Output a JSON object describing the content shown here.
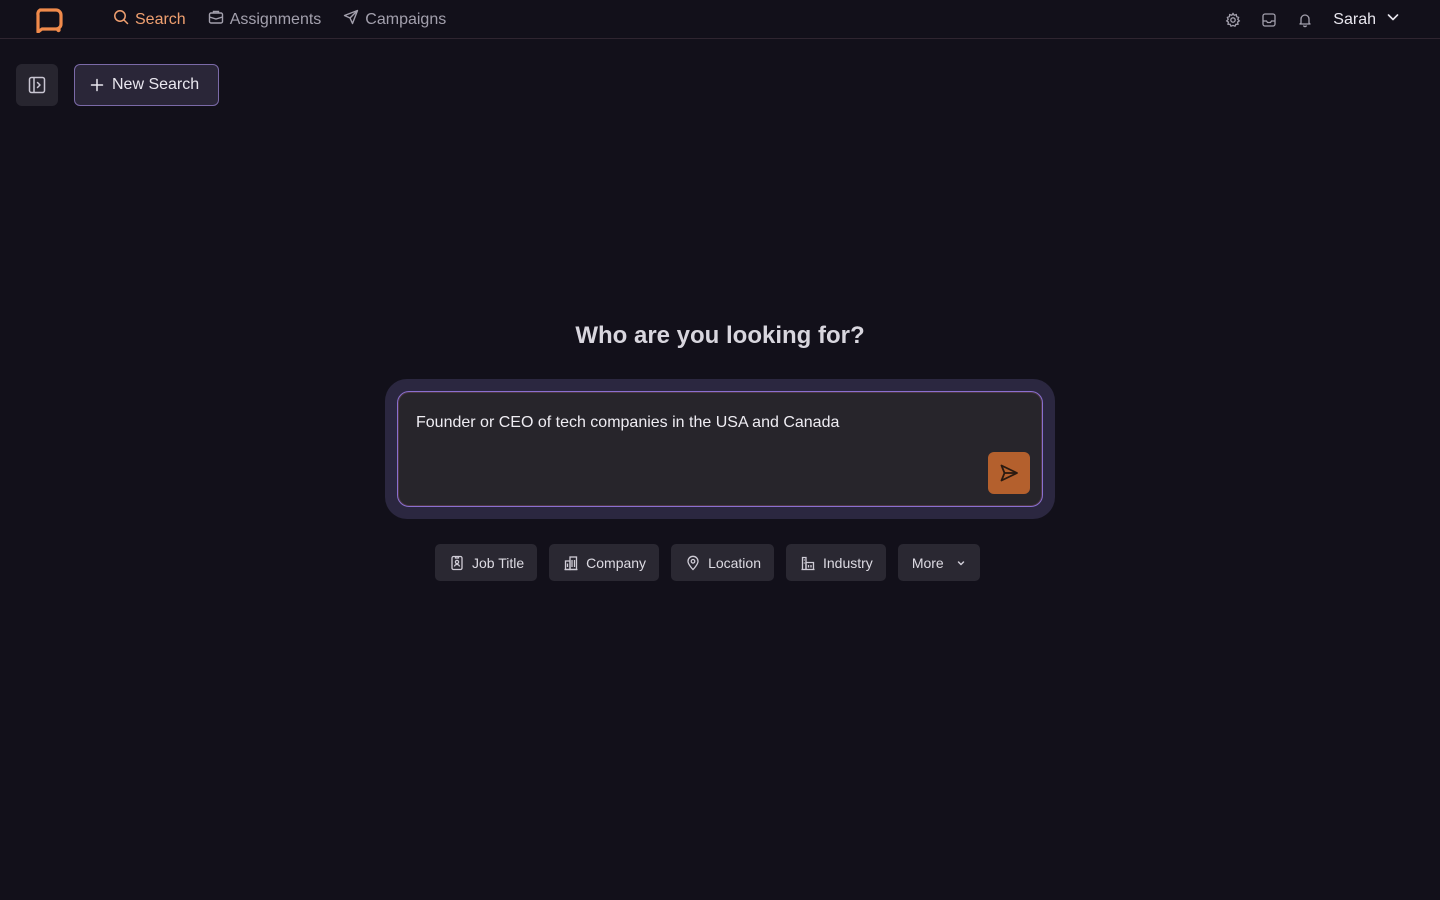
{
  "header": {
    "nav": [
      {
        "label": "Search",
        "icon": "search-icon",
        "active": true
      },
      {
        "label": "Assignments",
        "icon": "briefcase-icon",
        "active": false
      },
      {
        "label": "Campaigns",
        "icon": "send-icon",
        "active": false
      }
    ],
    "tools": [
      "gear-icon",
      "inbox-icon",
      "bell-icon"
    ],
    "user_name": "Sarah"
  },
  "toolbar": {
    "new_search_label": "New Search"
  },
  "main": {
    "heading": "Who are you looking for?",
    "query": "Founder or CEO of tech companies in the USA and Canada",
    "filters": [
      {
        "label": "Job Title",
        "icon": "badge-icon"
      },
      {
        "label": "Company",
        "icon": "building-icon"
      },
      {
        "label": "Location",
        "icon": "map-pin-icon"
      },
      {
        "label": "Industry",
        "icon": "factory-icon"
      },
      {
        "label": "More",
        "icon": "chevron-down-icon"
      }
    ]
  },
  "colors": {
    "background": "#12101a",
    "accent": "#f0a070",
    "send_button": "#b4602d",
    "input_border": "#8a6fd0"
  }
}
